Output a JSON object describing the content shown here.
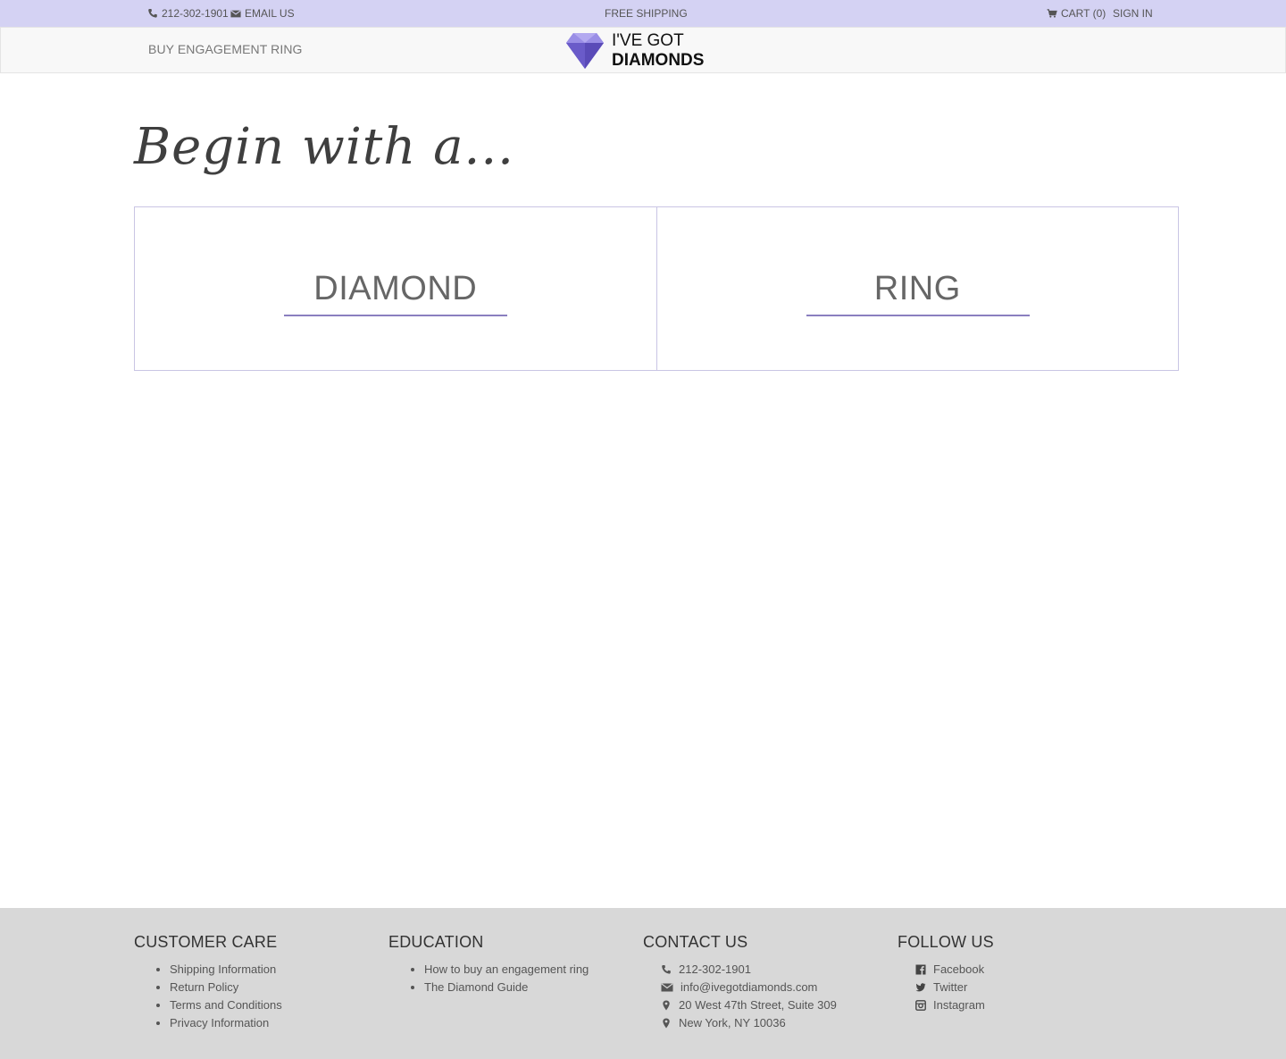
{
  "topbar": {
    "phone": "212-302-1901",
    "email_label": "EMAIL US",
    "shipping": "FREE SHIPPING",
    "cart_label": "CART (0)",
    "signin_label": "SIGN IN"
  },
  "nav": {
    "buy_link": "BUY ENGAGEMENT RING",
    "logo_line1": "I'VE GOT",
    "logo_line2": "DIAMONDS"
  },
  "main": {
    "heading": "Begin with a...",
    "choices": [
      {
        "label": "DIAMOND"
      },
      {
        "label": "RING"
      }
    ]
  },
  "footer": {
    "customer_care": {
      "title": "CUSTOMER CARE",
      "links": [
        "Shipping Information",
        "Return Policy",
        "Terms and Conditions",
        "Privacy Information"
      ]
    },
    "education": {
      "title": "EDUCATION",
      "links": [
        "How to buy an engagement ring",
        "The Diamond Guide"
      ]
    },
    "contact": {
      "title": "CONTACT US",
      "phone": "212-302-1901",
      "email": "info@ivegotdiamonds.com",
      "address1": "20 West 47th Street, Suite 309",
      "address2": "New York, NY 10036"
    },
    "follow": {
      "title": "FOLLOW US",
      "links": [
        "Facebook",
        "Twitter",
        "Instagram"
      ]
    }
  },
  "colors": {
    "topbar_bg": "#d4d2f3",
    "accent": "#8a7fbf",
    "footer_bg": "#d8d8d8"
  }
}
